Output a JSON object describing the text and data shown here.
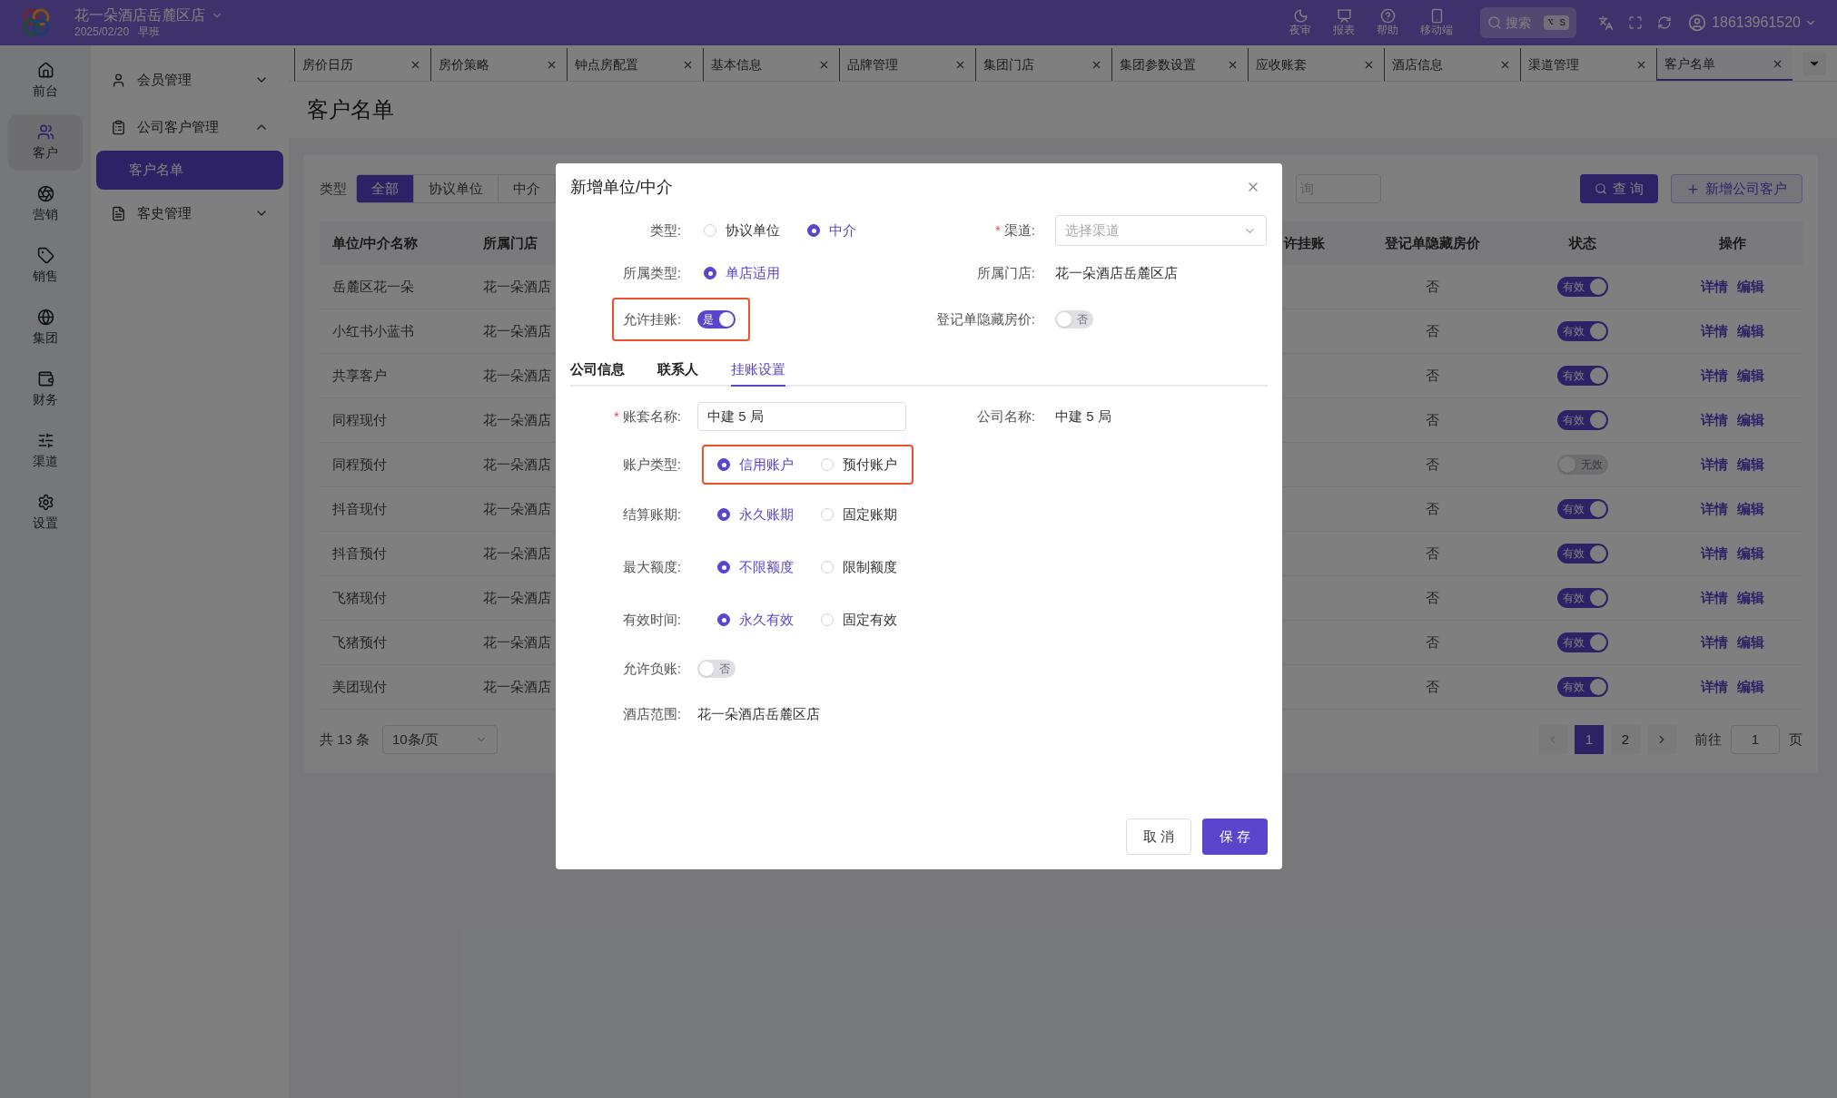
{
  "app": {
    "hotel": "花一朵酒店岳麓区店",
    "date": "2025/02/20",
    "shift": "早班"
  },
  "top_actions": [
    {
      "label": "夜审",
      "kind": "night"
    },
    {
      "label": "报表",
      "kind": "report"
    },
    {
      "label": "帮助",
      "kind": "help"
    },
    {
      "label": "移动端",
      "kind": "mobile"
    }
  ],
  "search": {
    "placeholder": "搜索",
    "shortcut": "⌥ S"
  },
  "user": "18613961520",
  "rail": [
    {
      "label": "前台",
      "kind": "home",
      "selected": false
    },
    {
      "label": "客户",
      "kind": "users",
      "selected": true
    },
    {
      "label": "营销",
      "kind": "marketing",
      "selected": false
    },
    {
      "label": "销售",
      "kind": "sales",
      "selected": false
    },
    {
      "label": "集团",
      "kind": "group",
      "selected": false
    },
    {
      "label": "财务",
      "kind": "finance",
      "selected": false
    },
    {
      "label": "渠道",
      "kind": "channel",
      "selected": false
    },
    {
      "label": "设置",
      "kind": "settings",
      "selected": false
    }
  ],
  "menu": [
    {
      "label": "会员管理",
      "kind": "user",
      "expanded": false
    },
    {
      "label": "公司客户管理",
      "kind": "company",
      "expanded": true,
      "children": [
        {
          "label": "客户名单",
          "selected": true
        }
      ]
    },
    {
      "label": "客史管理",
      "kind": "history",
      "expanded": false
    }
  ],
  "tabs": [
    {
      "label": "房价日历",
      "selected": false
    },
    {
      "label": "房价策略",
      "selected": false
    },
    {
      "label": "钟点房配置",
      "selected": false
    },
    {
      "label": "基本信息",
      "selected": false
    },
    {
      "label": "品牌管理",
      "selected": false
    },
    {
      "label": "集团门店",
      "selected": false
    },
    {
      "label": "集团参数设置",
      "selected": false
    },
    {
      "label": "应收账套",
      "selected": false
    },
    {
      "label": "酒店信息",
      "selected": false
    },
    {
      "label": "渠道管理",
      "selected": false
    },
    {
      "label": "客户名单",
      "selected": true
    }
  ],
  "page_title": "客户名单",
  "filter": {
    "label": "类型",
    "options": [
      {
        "label": "全部",
        "selected": true
      },
      {
        "label": "协议单位",
        "selected": false
      },
      {
        "label": "中介",
        "selected": false
      }
    ],
    "search_placeholder": "询",
    "query_button": "查 询",
    "add_button": "新增公司客户"
  },
  "table": {
    "columns": [
      "单位/中介名称",
      "所属门店",
      "许挂账",
      "登记单隐藏房价",
      "状态",
      "操作"
    ],
    "rows": [
      {
        "name": "岳麓区花一朵",
        "store": "花一朵酒店",
        "hide_price": "否",
        "status": {
          "label": "有效",
          "on": true
        },
        "actions": [
          "详情",
          "编辑"
        ]
      },
      {
        "name": "小红书小蓝书",
        "store": "花一朵酒店",
        "hide_price": "否",
        "status": {
          "label": "有效",
          "on": true
        },
        "actions": [
          "详情",
          "编辑"
        ]
      },
      {
        "name": "共享客户",
        "store": "花一朵酒店",
        "hide_price": "否",
        "status": {
          "label": "有效",
          "on": true
        },
        "actions": [
          "详情",
          "编辑"
        ]
      },
      {
        "name": "同程现付",
        "store": "花一朵酒店",
        "hide_price": "否",
        "status": {
          "label": "有效",
          "on": true
        },
        "actions": [
          "详情",
          "编辑"
        ]
      },
      {
        "name": "同程预付",
        "store": "花一朵酒店",
        "hide_price": "否",
        "status": {
          "label": "无效",
          "on": false
        },
        "actions": [
          "详情",
          "编辑"
        ]
      },
      {
        "name": "抖音现付",
        "store": "花一朵酒店",
        "hide_price": "否",
        "status": {
          "label": "有效",
          "on": true
        },
        "actions": [
          "详情",
          "编辑"
        ]
      },
      {
        "name": "抖音预付",
        "store": "花一朵酒店",
        "hide_price": "否",
        "status": {
          "label": "有效",
          "on": true
        },
        "actions": [
          "详情",
          "编辑"
        ]
      },
      {
        "name": "飞猪现付",
        "store": "花一朵酒店",
        "hide_price": "否",
        "status": {
          "label": "有效",
          "on": true
        },
        "actions": [
          "详情",
          "编辑"
        ]
      },
      {
        "name": "飞猪预付",
        "store": "花一朵酒店",
        "hide_price": "否",
        "status": {
          "label": "有效",
          "on": true
        },
        "actions": [
          "详情",
          "编辑"
        ]
      },
      {
        "name": "美团现付",
        "store": "花一朵酒店",
        "hide_price": "否",
        "status": {
          "label": "有效",
          "on": true
        },
        "actions": [
          "详情",
          "编辑"
        ]
      }
    ]
  },
  "pagination": {
    "total": "共 13 条",
    "page_size": "10条/页",
    "pages": [
      {
        "label": "1",
        "selected": true
      },
      {
        "label": "2",
        "selected": false
      }
    ],
    "goto_label": "前往",
    "goto_value": "1",
    "page_suffix": "页"
  },
  "dialog": {
    "title": "新增单位/中介",
    "type": {
      "label": "类型:",
      "options": [
        {
          "label": "协议单位",
          "selected": false
        },
        {
          "label": "中介",
          "selected": true
        }
      ]
    },
    "channel": {
      "label": "渠道:",
      "mark": "*",
      "placeholder": "选择渠道"
    },
    "scope_type": {
      "label": "所属类型:",
      "options": [
        {
          "label": "单店适用",
          "selected": true
        }
      ]
    },
    "store": {
      "label": "所属门店:",
      "value": "花一朵酒店岳麓区店"
    },
    "allow_credit": {
      "label": "允许挂账:",
      "on": true,
      "text": "是",
      "highlighted": true
    },
    "hide_price": {
      "label": "登记单隐藏房价:",
      "on": false,
      "text": "否"
    },
    "tabs": [
      {
        "label": "公司信息",
        "selected": false
      },
      {
        "label": "联系人",
        "selected": false
      },
      {
        "label": "挂账设置",
        "selected": true
      }
    ],
    "ledger_name": {
      "label": "账套名称:",
      "mark": "*",
      "value": "中建 5 局"
    },
    "company_name": {
      "label": "公司名称:",
      "value": "中建 5 局"
    },
    "radio_groups": [
      {
        "label": "账户类型:",
        "highlighted": true,
        "options": [
          {
            "label": "信用账户",
            "selected": true
          },
          {
            "label": "预付账户",
            "selected": false
          }
        ]
      },
      {
        "label": "结算账期:",
        "highlighted": false,
        "options": [
          {
            "label": "永久账期",
            "selected": true
          },
          {
            "label": "固定账期",
            "selected": false
          }
        ]
      },
      {
        "label": "最大额度:",
        "highlighted": false,
        "options": [
          {
            "label": "不限额度",
            "selected": true
          },
          {
            "label": "限制额度",
            "selected": false
          }
        ]
      },
      {
        "label": "有效时间:",
        "highlighted": false,
        "options": [
          {
            "label": "永久有效",
            "selected": true
          },
          {
            "label": "固定有效",
            "selected": false
          }
        ]
      }
    ],
    "allow_negative": {
      "label": "允许负账:",
      "on": false,
      "text": "否"
    },
    "hotel_scope": {
      "label": "酒店范围:",
      "value": "花一朵酒店岳麓区店"
    },
    "buttons": [
      {
        "label": "取 消",
        "kind": "default"
      },
      {
        "label": "保 存",
        "kind": "primary"
      }
    ]
  }
}
